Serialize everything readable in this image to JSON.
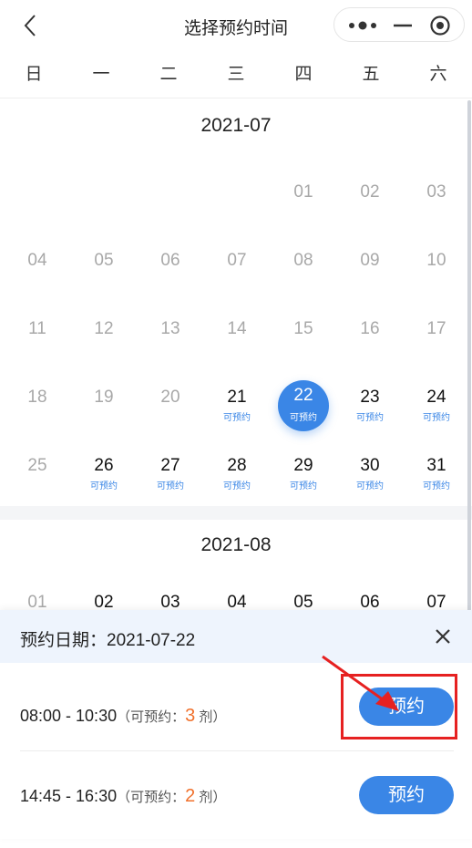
{
  "header": {
    "title": "选择预约时间"
  },
  "weekdays": [
    "日",
    "一",
    "二",
    "三",
    "四",
    "五",
    "六"
  ],
  "months": [
    {
      "title": "2021-07",
      "days": [
        {
          "n": "01",
          "s": "gray",
          "tag": ""
        },
        {
          "n": "02",
          "s": "gray",
          "tag": ""
        },
        {
          "n": "03",
          "s": "gray",
          "tag": ""
        },
        {
          "n": "04",
          "s": "gray",
          "tag": ""
        },
        {
          "n": "05",
          "s": "gray",
          "tag": ""
        },
        {
          "n": "06",
          "s": "gray",
          "tag": ""
        },
        {
          "n": "07",
          "s": "gray",
          "tag": ""
        },
        {
          "n": "08",
          "s": "gray",
          "tag": ""
        },
        {
          "n": "09",
          "s": "gray",
          "tag": ""
        },
        {
          "n": "10",
          "s": "gray",
          "tag": ""
        },
        {
          "n": "11",
          "s": "gray",
          "tag": ""
        },
        {
          "n": "12",
          "s": "gray",
          "tag": ""
        },
        {
          "n": "13",
          "s": "gray",
          "tag": ""
        },
        {
          "n": "14",
          "s": "gray",
          "tag": ""
        },
        {
          "n": "15",
          "s": "gray",
          "tag": ""
        },
        {
          "n": "16",
          "s": "gray",
          "tag": ""
        },
        {
          "n": "17",
          "s": "gray",
          "tag": ""
        },
        {
          "n": "18",
          "s": "gray",
          "tag": ""
        },
        {
          "n": "19",
          "s": "gray",
          "tag": ""
        },
        {
          "n": "20",
          "s": "gray",
          "tag": ""
        },
        {
          "n": "21",
          "s": "black",
          "tag": "可预约"
        },
        {
          "n": "22",
          "s": "selected",
          "tag": "可预约"
        },
        {
          "n": "23",
          "s": "black",
          "tag": "可预约"
        },
        {
          "n": "24",
          "s": "black",
          "tag": "可预约"
        },
        {
          "n": "25",
          "s": "gray",
          "tag": ""
        },
        {
          "n": "26",
          "s": "black",
          "tag": "可预约"
        },
        {
          "n": "27",
          "s": "black",
          "tag": "可预约"
        },
        {
          "n": "28",
          "s": "black",
          "tag": "可预约"
        },
        {
          "n": "29",
          "s": "black",
          "tag": "可预约"
        },
        {
          "n": "30",
          "s": "black",
          "tag": "可预约"
        },
        {
          "n": "31",
          "s": "black",
          "tag": "可预约"
        }
      ]
    },
    {
      "title": "2021-08",
      "days": [
        {
          "n": "01",
          "s": "gray",
          "tag": ""
        },
        {
          "n": "02",
          "s": "black",
          "tag": ""
        },
        {
          "n": "03",
          "s": "black",
          "tag": ""
        },
        {
          "n": "04",
          "s": "black",
          "tag": ""
        },
        {
          "n": "05",
          "s": "black",
          "tag": ""
        },
        {
          "n": "06",
          "s": "black",
          "tag": ""
        },
        {
          "n": "07",
          "s": "black",
          "tag": ""
        }
      ]
    }
  ],
  "panel": {
    "date_label": "预约日期：2021-07-22",
    "slots": [
      {
        "time": "08:00 - 10:30",
        "pre": "（可预约：",
        "count": "3",
        "post": " 剂）",
        "button": "预约"
      },
      {
        "time": "14:45 - 16:30",
        "pre": "（可预约：",
        "count": "2",
        "post": " 剂）",
        "button": "预约"
      }
    ]
  },
  "colors": {
    "accent": "#3a86e6",
    "count": "#f0702b",
    "annotation": "#e62121"
  }
}
